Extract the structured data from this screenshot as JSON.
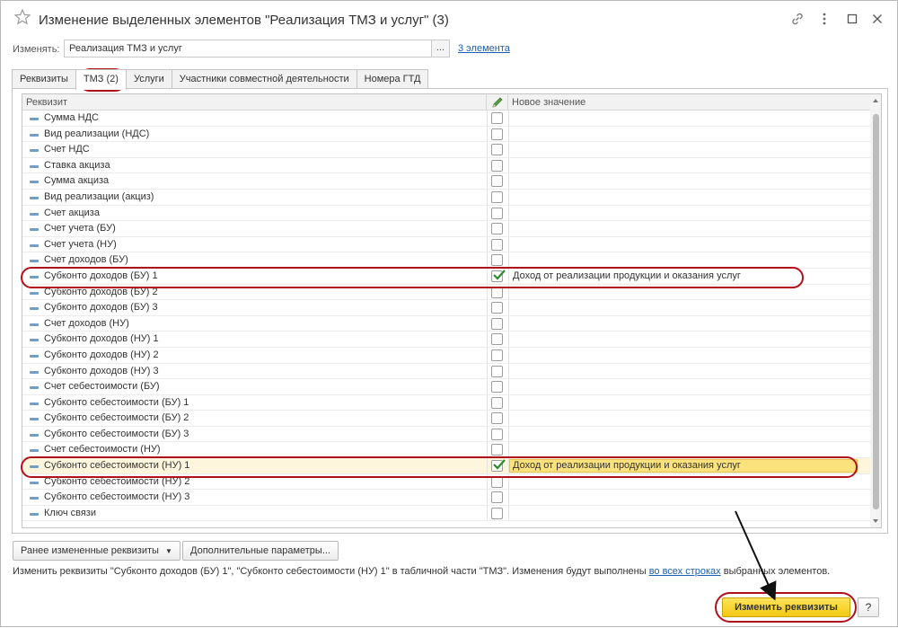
{
  "window": {
    "title": "Изменение выделенных элементов \"Реализация ТМЗ и услуг\" (3)"
  },
  "change": {
    "label": "Изменять:",
    "value": "Реализация ТМЗ и услуг",
    "select_label": "...",
    "elements_link": "3 элемента"
  },
  "tabs": [
    {
      "label": "Реквизиты",
      "active": false
    },
    {
      "label": "ТМЗ (2)",
      "active": true
    },
    {
      "label": "Услуги",
      "active": false
    },
    {
      "label": "Участники совместной деятельности",
      "active": false
    },
    {
      "label": "Номера ГТД",
      "active": false
    }
  ],
  "grid": {
    "col_attribute": "Реквизит",
    "col_new_value": "Новое значение",
    "rows": [
      {
        "name": "Сумма НДС",
        "checked": false,
        "value": ""
      },
      {
        "name": "Вид реализации (НДС)",
        "checked": false,
        "value": ""
      },
      {
        "name": "Счет НДС",
        "checked": false,
        "value": ""
      },
      {
        "name": "Ставка акциза",
        "checked": false,
        "value": ""
      },
      {
        "name": "Сумма акциза",
        "checked": false,
        "value": ""
      },
      {
        "name": "Вид реализации (акциз)",
        "checked": false,
        "value": ""
      },
      {
        "name": "Счет акциза",
        "checked": false,
        "value": ""
      },
      {
        "name": "Счет учета (БУ)",
        "checked": false,
        "value": ""
      },
      {
        "name": "Счет учета (НУ)",
        "checked": false,
        "value": ""
      },
      {
        "name": "Счет доходов (БУ)",
        "checked": false,
        "value": ""
      },
      {
        "name": "Субконто доходов (БУ) 1",
        "checked": true,
        "value": "Доход от реализации продукции и оказания услуг"
      },
      {
        "name": "Субконто доходов (БУ) 2",
        "checked": false,
        "value": ""
      },
      {
        "name": "Субконто доходов (БУ) 3",
        "checked": false,
        "value": ""
      },
      {
        "name": "Счет доходов (НУ)",
        "checked": false,
        "value": ""
      },
      {
        "name": "Субконто доходов (НУ) 1",
        "checked": false,
        "value": ""
      },
      {
        "name": "Субконто доходов (НУ) 2",
        "checked": false,
        "value": ""
      },
      {
        "name": "Субконто доходов (НУ) 3",
        "checked": false,
        "value": ""
      },
      {
        "name": "Счет себестоимости (БУ)",
        "checked": false,
        "value": ""
      },
      {
        "name": "Субконто себестоимости (БУ) 1",
        "checked": false,
        "value": ""
      },
      {
        "name": "Субконто себестоимости (БУ) 2",
        "checked": false,
        "value": ""
      },
      {
        "name": "Субконто себестоимости (БУ) 3",
        "checked": false,
        "value": ""
      },
      {
        "name": "Счет себестоимости (НУ)",
        "checked": false,
        "value": ""
      },
      {
        "name": "Субконто себестоимости (НУ) 1",
        "checked": true,
        "value": "Доход от реализации продукции и оказания услуг",
        "selected": true
      },
      {
        "name": "Субконто себестоимости (НУ) 2",
        "checked": false,
        "value": ""
      },
      {
        "name": "Субконто себестоимости (НУ) 3",
        "checked": false,
        "value": ""
      },
      {
        "name": "Ключ связи",
        "checked": false,
        "value": ""
      }
    ]
  },
  "buttons": {
    "previous_label": "Ранее измененные реквизиты",
    "additional_label": "Дополнительные параметры...",
    "apply_label": "Изменить реквизиты",
    "help_label": "?"
  },
  "info": {
    "before": "Изменить реквизиты \"Субконто доходов (БУ) 1\", \"Субконто себестоимости (НУ) 1\" в табличной части \"ТМЗ\". Изменения будут выполнены ",
    "link": "во всех строках",
    "after": " выбранных элементов."
  },
  "colors": {
    "accent_yellow": "#f2c811",
    "selected_row": "#fdf6dc",
    "annotation_red": "#b0101a",
    "link_blue": "#1a5fb4"
  }
}
